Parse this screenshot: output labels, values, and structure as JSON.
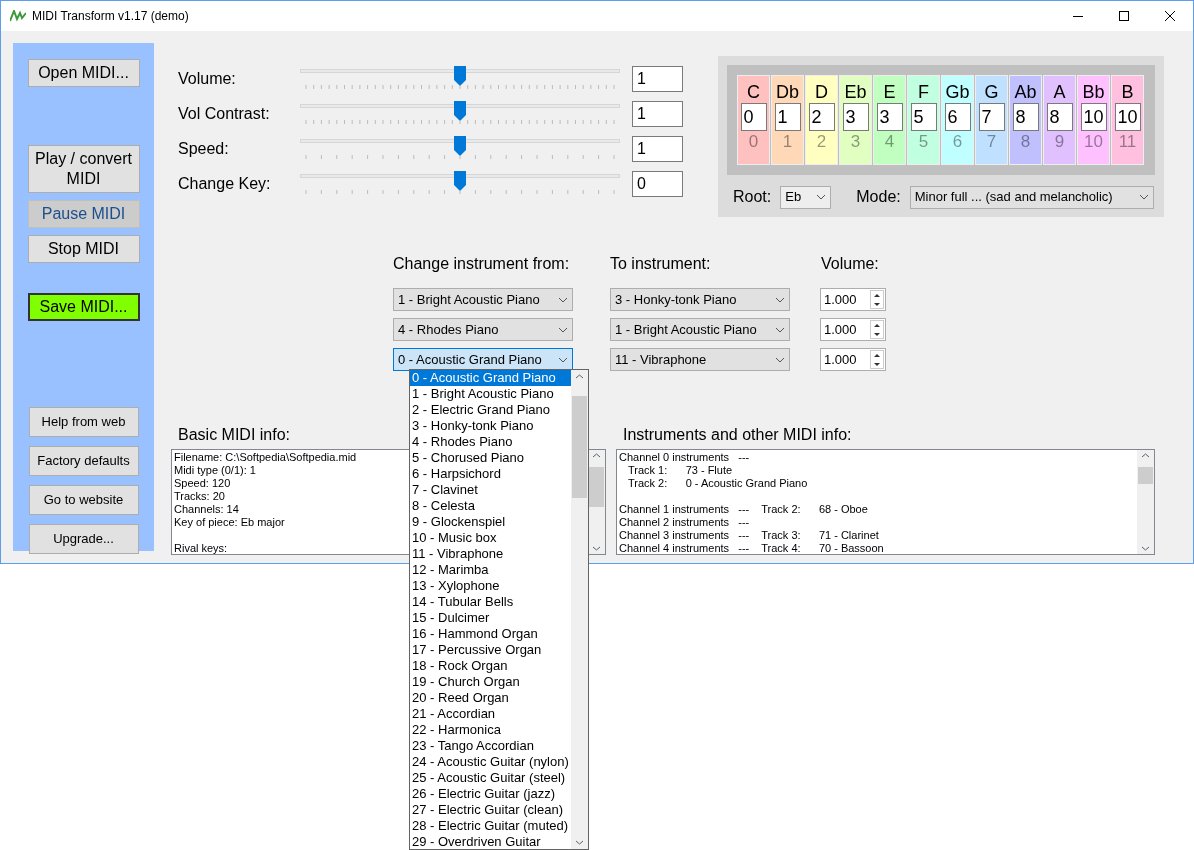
{
  "window": {
    "title": "MIDI Transform v1.17 (demo)"
  },
  "left_panel": {
    "groups": [
      [
        {
          "label": "Open MIDI...",
          "kind": "normal"
        }
      ],
      [
        {
          "label": "Play / convert MIDI",
          "kind": "normal"
        },
        {
          "label": "Pause MIDI",
          "kind": "disabled"
        },
        {
          "label": "Stop MIDI",
          "kind": "normal"
        }
      ],
      [
        {
          "label": "Save MIDI...",
          "kind": "accent"
        }
      ],
      [
        {
          "label": "Help from web",
          "kind": "small"
        },
        {
          "label": "Factory defaults",
          "kind": "small"
        },
        {
          "label": "Go to website",
          "kind": "small"
        },
        {
          "label": "Upgrade...",
          "kind": "small"
        }
      ]
    ]
  },
  "sliders": [
    {
      "label": "Volume:",
      "level": 0.5,
      "value": "1"
    },
    {
      "label": "Vol Contrast:",
      "level": 0.5,
      "value": "1"
    },
    {
      "label": "Speed:",
      "level": 0.5,
      "value": "1"
    },
    {
      "label": "Change Key:",
      "level": 0.5,
      "value": "0"
    }
  ],
  "keys": [
    {
      "note": "C",
      "value": "0",
      "degree": "0",
      "color": "#ffc0c0"
    },
    {
      "note": "Db",
      "value": "1",
      "degree": "1",
      "color": "#ffd8b8"
    },
    {
      "note": "D",
      "value": "2",
      "degree": "2",
      "color": "#ffffc0"
    },
    {
      "note": "Eb",
      "value": "3",
      "degree": "3",
      "color": "#e0ffc0"
    },
    {
      "note": "E",
      "value": "3",
      "degree": "4",
      "color": "#c0ffc0"
    },
    {
      "note": "F",
      "value": "5",
      "degree": "5",
      "color": "#c0ffe0"
    },
    {
      "note": "Gb",
      "value": "6",
      "degree": "6",
      "color": "#c0ffff"
    },
    {
      "note": "G",
      "value": "7",
      "degree": "7",
      "color": "#c0e0ff"
    },
    {
      "note": "Ab",
      "value": "8",
      "degree": "8",
      "color": "#c0c0ff"
    },
    {
      "note": "A",
      "value": "8",
      "degree": "9",
      "color": "#e0c0ff"
    },
    {
      "note": "Bb",
      "value": "10",
      "degree": "10",
      "color": "#ffc0ff"
    },
    {
      "note": "B",
      "value": "10",
      "degree": "11",
      "color": "#ffc0e0"
    }
  ],
  "root": {
    "label": "Root:",
    "value": "Eb"
  },
  "mode": {
    "label": "Mode:",
    "value": "Minor full ... (sad and melancholic)"
  },
  "instrument_changes": {
    "headers": [
      "Change instrument from:",
      "To instrument:",
      "Volume:"
    ],
    "rows": [
      {
        "from": "1 - Bright Acoustic Piano",
        "from_open": false,
        "to": "3 - Honky-tonk Piano",
        "volume": "1.000"
      },
      {
        "from": "4 - Rhodes Piano",
        "from_open": false,
        "to": "1 - Bright Acoustic Piano",
        "volume": "1.000"
      },
      {
        "from": "0 - Acoustic Grand Piano",
        "from_open": true,
        "to": "11 - Vibraphone",
        "volume": "1.000"
      }
    ]
  },
  "dropdown_list": {
    "items": [
      {
        "label": "0 - Acoustic Grand Piano",
        "selected": true
      },
      {
        "label": "1 - Bright Acoustic Piano",
        "selected": false
      },
      {
        "label": "2 - Electric Grand Piano",
        "selected": false
      },
      {
        "label": "3 - Honky-tonk Piano",
        "selected": false
      },
      {
        "label": "4 - Rhodes Piano",
        "selected": false
      },
      {
        "label": "5 - Chorused Piano",
        "selected": false
      },
      {
        "label": "6 - Harpsichord",
        "selected": false
      },
      {
        "label": "7 - Clavinet",
        "selected": false
      },
      {
        "label": "8 - Celesta",
        "selected": false
      },
      {
        "label": "9 - Glockenspiel",
        "selected": false
      },
      {
        "label": "10 - Music box",
        "selected": false
      },
      {
        "label": "11 - Vibraphone",
        "selected": false
      },
      {
        "label": "12 - Marimba",
        "selected": false
      },
      {
        "label": "13 - Xylophone",
        "selected": false
      },
      {
        "label": "14 - Tubular Bells",
        "selected": false
      },
      {
        "label": "15 - Dulcimer",
        "selected": false
      },
      {
        "label": "16 - Hammond Organ",
        "selected": false
      },
      {
        "label": "17 - Percussive Organ",
        "selected": false
      },
      {
        "label": "18 - Rock Organ",
        "selected": false
      },
      {
        "label": "19 - Church Organ",
        "selected": false
      },
      {
        "label": "20 - Reed Organ",
        "selected": false
      },
      {
        "label": "21 - Accordian",
        "selected": false
      },
      {
        "label": "22 - Harmonica",
        "selected": false
      },
      {
        "label": "23 - Tango Accordian",
        "selected": false
      },
      {
        "label": "24 - Acoustic Guitar (nylon)",
        "selected": false
      },
      {
        "label": "25 - Acoustic Guitar (steel)",
        "selected": false
      },
      {
        "label": "26 - Electric Guitar (jazz)",
        "selected": false
      },
      {
        "label": "27 - Electric Guitar (clean)",
        "selected": false
      },
      {
        "label": "28 - Electric Guitar (muted)",
        "selected": false
      },
      {
        "label": "29 - Overdriven Guitar",
        "selected": false
      }
    ]
  },
  "basic_info": {
    "title": "Basic MIDI info:",
    "paragraphs": [
      [
        "Filename: C:\\Softpedia\\Softpedia.mid",
        "Midi type (0/1): 1",
        "Speed: 120",
        "Tracks: 20",
        "Channels: 14",
        "Key of piece: Eb major"
      ],
      [
        "Rival keys:"
      ]
    ]
  },
  "instruments_info": {
    "title": "Instruments and other MIDI info:",
    "paragraphs": [
      [
        "Channel 0 instruments   ---",
        "   Track 1:      73 - Flute",
        "   Track 2:      0 - Acoustic Grand Piano"
      ],
      [
        "Channel 1 instruments   ---    Track 2:      68 - Oboe",
        "Channel 2 instruments   ---",
        "Channel 3 instruments   ---    Track 3:      71 - Clarinet",
        "Channel 4 instruments   ---    Track 4:      70 - Bassoon"
      ]
    ]
  }
}
